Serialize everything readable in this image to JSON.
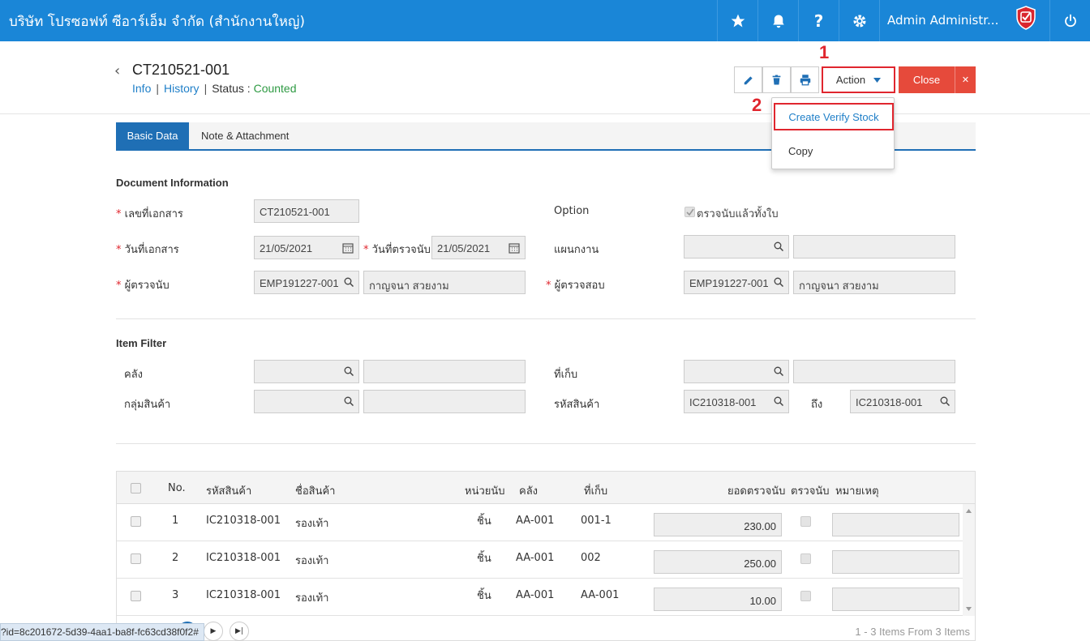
{
  "topbar": {
    "company": "บริษัท โปรซอฟท์ ซีอาร์เอ็ม จำกัด (สำนักงานใหญ่)",
    "user": "Admin Administr...",
    "bg_color": "#1a86d7"
  },
  "header": {
    "doc_no": "CT210521-001",
    "link_info": "Info",
    "link_history": "History",
    "status_label": "Status",
    "status_sep": ":",
    "status_value": "Counted",
    "action_label": "Action",
    "close_label": "Close",
    "sep": "|"
  },
  "annotations": {
    "one": "1",
    "two": "2"
  },
  "dropdown": {
    "item1": "Create Verify Stock",
    "item2": "Copy"
  },
  "tabs": {
    "basic": "Basic Data",
    "note": "Note & Attachment"
  },
  "doc_info": {
    "title": "Document Information",
    "doc_no_label": "เลขที่เอกสาร",
    "doc_no_value": "CT210521-001",
    "option_label": "Option",
    "option_check": "ตรวจนับแล้วทั้งใบ",
    "doc_date_label": "วันที่เอกสาร",
    "doc_date_value": "21/05/2021",
    "count_date_label": "วันที่ตรวจนับ",
    "count_date_value": "21/05/2021",
    "dept_label": "แผนกงาน",
    "counter_label": "ผู้ตรวจนับ",
    "counter_code": "EMP191227-001",
    "counter_name": "กาญจนา สวยงาม",
    "checker_label": "ผู้ตรวจสอบ",
    "checker_code": "EMP191227-001",
    "checker_name": "กาญจนา สวยงาม",
    "required_mark": "*"
  },
  "item_filter": {
    "title": "Item Filter",
    "warehouse_label": "คลัง",
    "location_label": "ที่เก็บ",
    "group_label": "กลุ่มสินค้า",
    "product_label": "รหัสสินค้า",
    "product_from": "IC210318-001",
    "to_label": "ถึง",
    "product_to": "IC210318-001"
  },
  "grid": {
    "headers": {
      "no": "No.",
      "code": "รหัสสินค้า",
      "name": "ชื่อสินค้า",
      "unit": "หน่วยนับ",
      "warehouse": "คลัง",
      "location": "ที่เก็บ",
      "count": "ยอดตรวจนับ",
      "counted": "ตรวจนับ",
      "remark": "หมายเหตุ"
    },
    "rows": [
      {
        "no": "1",
        "code": "IC210318-001",
        "name": "รองเท้า",
        "unit": "ชิ้น",
        "warehouse": "AA-001",
        "location": "001-1",
        "count": "230.00"
      },
      {
        "no": "2",
        "code": "IC210318-001",
        "name": "รองเท้า",
        "unit": "ชิ้น",
        "warehouse": "AA-001",
        "location": "002",
        "count": "250.00"
      },
      {
        "no": "3",
        "code": "IC210318-001",
        "name": "รองเท้า",
        "unit": "ชิ้น",
        "warehouse": "AA-001",
        "location": "AA-001",
        "count": "10.00"
      }
    ],
    "footer": "1 - 3 Items From 3 Items"
  },
  "statusbar": {
    "url": "?id=8c201672-5d39-4aa1-ba8f-fc63cd38f0f2#"
  }
}
